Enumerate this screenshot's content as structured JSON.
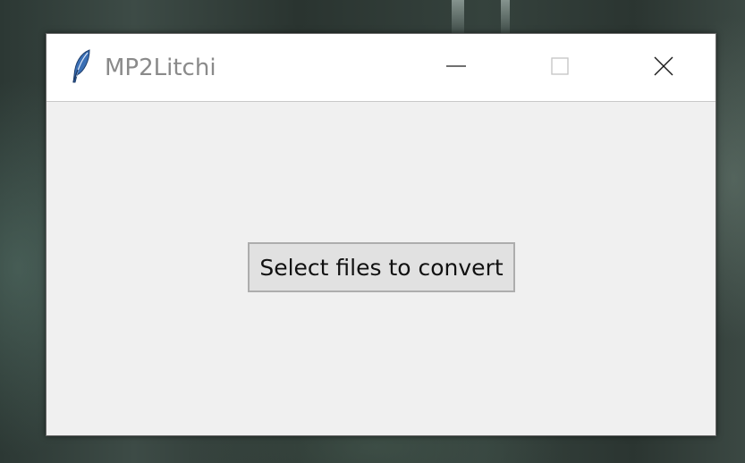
{
  "window": {
    "title": "MP2Litchi",
    "app_icon": "feather-icon",
    "controls": {
      "minimize_icon": "minimize-icon",
      "maximize_icon": "maximize-icon",
      "close_icon": "close-icon"
    }
  },
  "main": {
    "select_button_label": "Select files to convert"
  },
  "colors": {
    "titlebar_bg": "#ffffff",
    "title_text": "#8a8a8a",
    "content_bg": "#f0f0f0",
    "button_bg": "#e1e1e1",
    "button_border": "#adadad",
    "feather_blue": "#3a6fb5"
  }
}
